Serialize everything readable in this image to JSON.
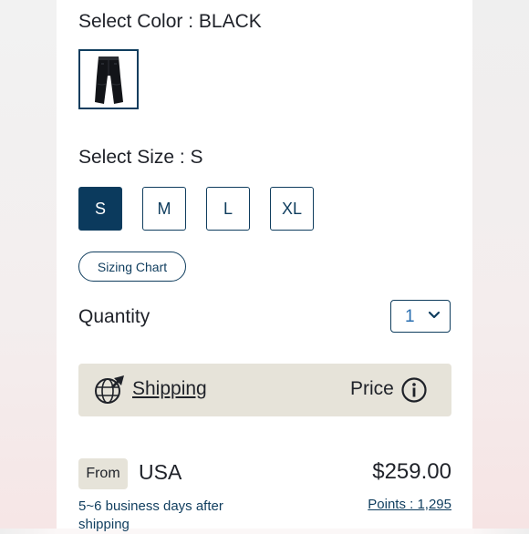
{
  "color_section": {
    "label": "Select Color : BLACK",
    "swatches": [
      {
        "name": "BLACK",
        "image": "black pants"
      }
    ]
  },
  "size_section": {
    "label": "Select Size : S",
    "sizes": [
      {
        "label": "S",
        "selected": true
      },
      {
        "label": "M",
        "selected": false
      },
      {
        "label": "L",
        "selected": false
      },
      {
        "label": "XL",
        "selected": false
      }
    ],
    "sizing_chart_label": "Sizing Chart"
  },
  "quantity": {
    "label": "Quantity",
    "value": "1"
  },
  "shipping_bar": {
    "icon": "globe-plane-icon",
    "shipping_label": "Shipping",
    "price_label": "Price",
    "info_icon": "info-icon"
  },
  "shipping_option": {
    "from_label": "From",
    "country": "USA",
    "price": "$259.00",
    "eta": "5~6 business days after shipping",
    "points": "Points : 1,295"
  },
  "colors": {
    "navy": "#0f3d5e",
    "selected_bg": "#0b3a5d",
    "beige": "#e6e3d9",
    "qty_value": "#2a6fb0"
  }
}
